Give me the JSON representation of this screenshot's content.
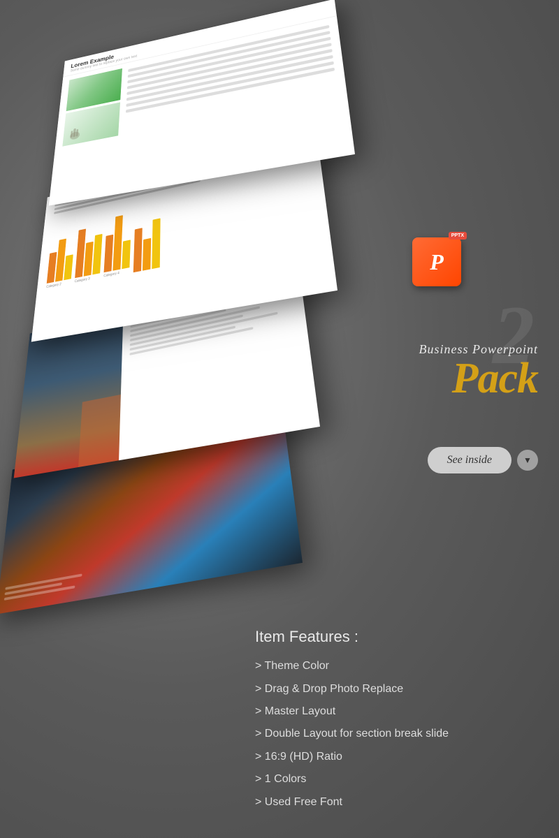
{
  "background": {
    "color": "#6b6b6b"
  },
  "slides": {
    "stack": [
      {
        "id": "slide-1",
        "type": "text-image",
        "title": "Lorem Example",
        "subtitle": "Some dummy text to replace your own text"
      },
      {
        "id": "slide-2",
        "type": "chart",
        "categories": [
          "Category 2",
          "Category 3",
          "Category 4"
        ]
      },
      {
        "id": "slide-3",
        "type": "architecture",
        "description": "Architecture photo slide"
      },
      {
        "id": "slide-4",
        "type": "dark-photo",
        "description": "Dark architectural photo"
      }
    ]
  },
  "product": {
    "icon": "P",
    "badge": "PPTX",
    "big_number": "2",
    "subtitle": "Business Powerpoint",
    "title": "Pack"
  },
  "button": {
    "see_inside": "See inside",
    "dropdown_arrow": "▼"
  },
  "features": {
    "heading": "Item Features :",
    "items": [
      "> Theme Color",
      "> Drag & Drop Photo Replace",
      "> Master Layout",
      "> Double Layout for section break slide",
      "> 16:9 (HD) Ratio",
      "> 1 Colors",
      "> Used Free Font"
    ]
  },
  "colors": {
    "accent_gold": "#d4a017",
    "text_light": "#e8e8e8",
    "text_dim": "#dddddd",
    "bg_dark": "#6b6b6b"
  }
}
